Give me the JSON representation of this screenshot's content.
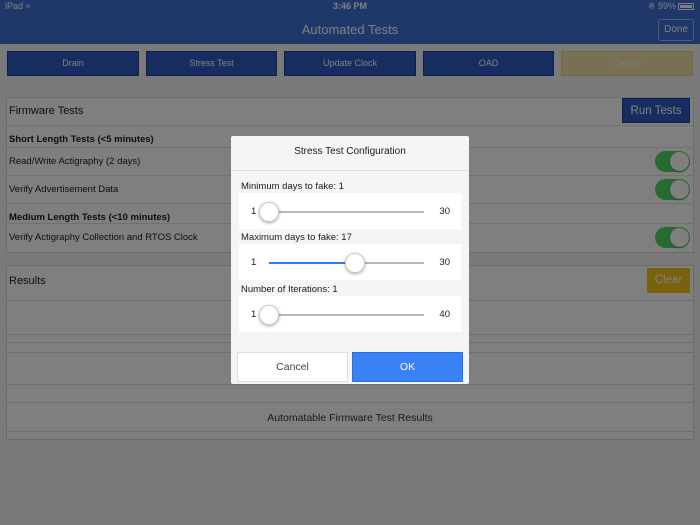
{
  "status_bar": {
    "carrier": "iPad",
    "time": "3:46 PM",
    "battery": "99%"
  },
  "nav": {
    "title": "Automated Tests",
    "done_label": "Done"
  },
  "toolbar": {
    "buttons": [
      "Drain",
      "Stress Test",
      "Update Clock",
      "OAD",
      "Cancel"
    ]
  },
  "firmware": {
    "title": "Firmware Tests",
    "run_label": "Run Tests",
    "rows": [
      {
        "label": "Short Length Tests (<5 minutes)"
      },
      {
        "label": "Read/Write Actigraphy (2 days)",
        "enabled": true
      },
      {
        "label": "Verify Advertisement Data",
        "enabled": true
      },
      {
        "label": "Medium Length Tests (<10 minutes)"
      },
      {
        "label": "Verify Actigraphy Collection and RTOS Clock",
        "enabled": true
      }
    ]
  },
  "results": {
    "title": "Results",
    "clear_label": "Clear",
    "footer": "Automatable Firmware Test Results"
  },
  "dialog": {
    "title": "Stress Test Configuration",
    "sliders": [
      {
        "label": "Minimum days to fake: 1",
        "min": "1",
        "max": "30",
        "value": 1
      },
      {
        "label": "Maximum days to fake: 17",
        "min": "1",
        "max": "30",
        "value": 17
      },
      {
        "label": "Number of Iterations: 1",
        "min": "1",
        "max": "40",
        "value": 1
      }
    ],
    "cancel_label": "Cancel",
    "ok_label": "OK"
  },
  "colors": {
    "accent": "#3f6ed3",
    "toggle_on": "#4cd964",
    "clear": "#f2c21d",
    "ok": "#3b82f6"
  }
}
